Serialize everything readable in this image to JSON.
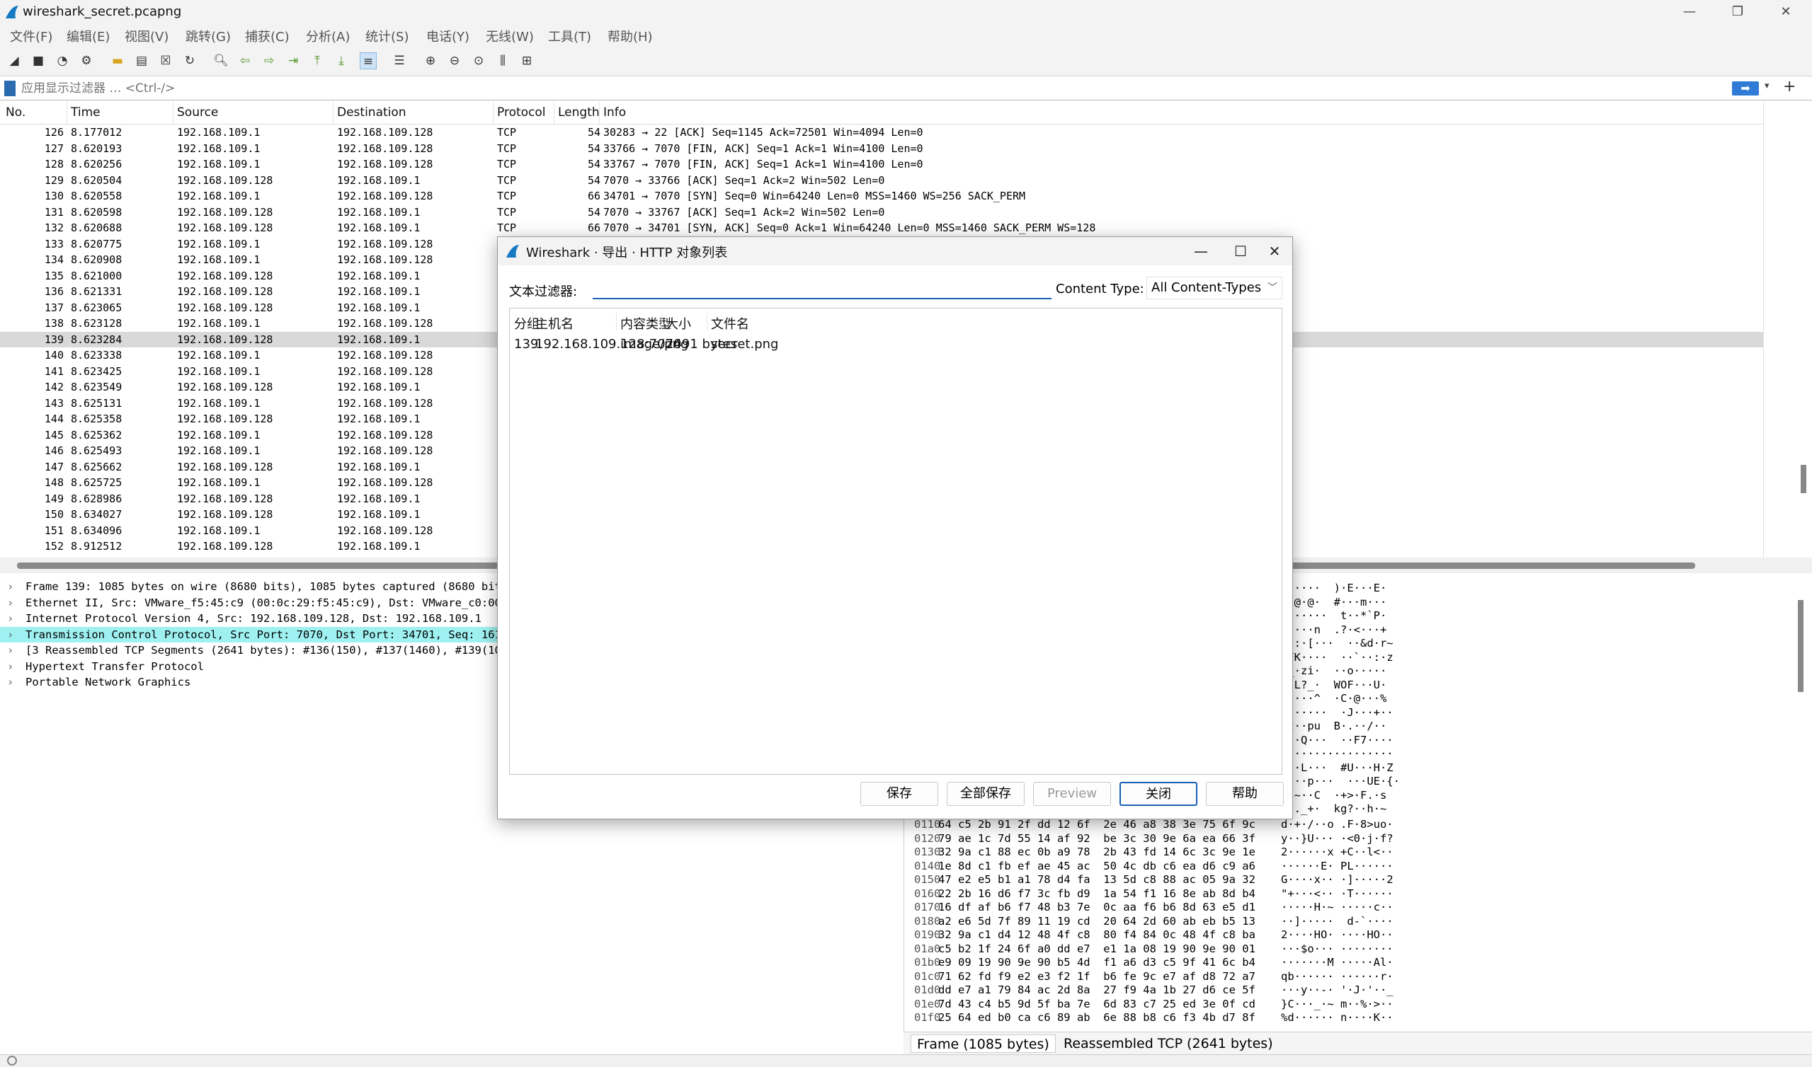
{
  "window": {
    "title": "wireshark_secret.pcapng",
    "controls": {
      "minimize": "—",
      "maximize": "❐",
      "close": "✕"
    }
  },
  "menubar": {
    "items": [
      "文件(F)",
      "编辑(E)",
      "视图(V)",
      "跳转(G)",
      "捕获(C)",
      "分析(A)",
      "统计(S)",
      "电话(Y)",
      "无线(W)",
      "工具(T)",
      "帮助(H)"
    ]
  },
  "filter": {
    "placeholder": "应用显示过滤器 … <Ctrl-/>"
  },
  "packet_list": {
    "columns": [
      "No.",
      "Time",
      "Source",
      "Destination",
      "Protocol",
      "Length",
      "Info"
    ],
    "rows": [
      {
        "no": "126",
        "time": "8.177012",
        "src": "192.168.109.1",
        "dst": "192.168.109.128",
        "proto": "TCP",
        "len": "54",
        "info": "30283 → 22 [ACK] Seq=1145 Ack=72501 Win=4094 Len=0"
      },
      {
        "no": "127",
        "time": "8.620193",
        "src": "192.168.109.1",
        "dst": "192.168.109.128",
        "proto": "TCP",
        "len": "54",
        "info": "33766 → 7070 [FIN, ACK] Seq=1 Ack=1 Win=4100 Len=0"
      },
      {
        "no": "128",
        "time": "8.620256",
        "src": "192.168.109.1",
        "dst": "192.168.109.128",
        "proto": "TCP",
        "len": "54",
        "info": "33767 → 7070 [FIN, ACK] Seq=1 Ack=1 Win=4100 Len=0"
      },
      {
        "no": "129",
        "time": "8.620504",
        "src": "192.168.109.128",
        "dst": "192.168.109.1",
        "proto": "TCP",
        "len": "54",
        "info": "7070 → 33766 [ACK] Seq=1 Ack=2 Win=502 Len=0"
      },
      {
        "no": "130",
        "time": "8.620558",
        "src": "192.168.109.1",
        "dst": "192.168.109.128",
        "proto": "TCP",
        "len": "66",
        "info": "34701 → 7070 [SYN] Seq=0 Win=64240 Len=0 MSS=1460 WS=256 SACK_PERM"
      },
      {
        "no": "131",
        "time": "8.620598",
        "src": "192.168.109.128",
        "dst": "192.168.109.1",
        "proto": "TCP",
        "len": "54",
        "info": "7070 → 33767 [ACK] Seq=1 Ack=2 Win=502 Len=0"
      },
      {
        "no": "132",
        "time": "8.620688",
        "src": "192.168.109.128",
        "dst": "192.168.109.1",
        "proto": "TCP",
        "len": "66",
        "info": "7070 → 34701 [SYN, ACK] Seq=0 Ack=1 Win=64240 Len=0 MSS=1460 SACK_PERM WS=128"
      },
      {
        "no": "133",
        "time": "8.620775",
        "src": "192.168.109.1",
        "dst": "192.168.109.128",
        "proto": "TCP",
        "len": "",
        "info": ""
      },
      {
        "no": "134",
        "time": "8.620908",
        "src": "192.168.109.1",
        "dst": "192.168.109.128",
        "proto": "TCP",
        "len": "",
        "info": ""
      },
      {
        "no": "135",
        "time": "8.621000",
        "src": "192.168.109.128",
        "dst": "192.168.109.1",
        "proto": "TCP",
        "len": "",
        "info": ""
      },
      {
        "no": "136",
        "time": "8.621331",
        "src": "192.168.109.128",
        "dst": "192.168.109.1",
        "proto": "TCP",
        "len": "",
        "info": ""
      },
      {
        "no": "137",
        "time": "8.623065",
        "src": "192.168.109.128",
        "dst": "192.168.109.1",
        "proto": "TCP",
        "len": "",
        "info": ""
      },
      {
        "no": "138",
        "time": "8.623128",
        "src": "192.168.109.1",
        "dst": "192.168.109.128",
        "proto": "TCP",
        "len": "",
        "info": ""
      },
      {
        "no": "139",
        "time": "8.623284",
        "src": "192.168.109.128",
        "dst": "192.168.109.1",
        "proto": "",
        "len": "",
        "info": "",
        "selected": true
      },
      {
        "no": "140",
        "time": "8.623338",
        "src": "192.168.109.1",
        "dst": "192.168.109.128",
        "proto": "TCP",
        "len": "",
        "info": ""
      },
      {
        "no": "141",
        "time": "8.623425",
        "src": "192.168.109.1",
        "dst": "192.168.109.128",
        "proto": "TCP",
        "len": "",
        "info": ""
      },
      {
        "no": "142",
        "time": "8.623549",
        "src": "192.168.109.128",
        "dst": "192.168.109.1",
        "proto": "TCP",
        "len": "",
        "info": ""
      },
      {
        "no": "143",
        "time": "8.625131",
        "src": "192.168.109.1",
        "dst": "192.168.109.128",
        "proto": "TCP",
        "len": "",
        "info": ""
      },
      {
        "no": "144",
        "time": "8.625358",
        "src": "192.168.109.128",
        "dst": "192.168.109.1",
        "proto": "TCP",
        "len": "",
        "info": ""
      },
      {
        "no": "145",
        "time": "8.625362",
        "src": "192.168.109.1",
        "dst": "192.168.109.128",
        "proto": "TCP",
        "len": "",
        "info": ""
      },
      {
        "no": "146",
        "time": "8.625493",
        "src": "192.168.109.1",
        "dst": "192.168.109.128",
        "proto": "TCP",
        "len": "",
        "info": ""
      },
      {
        "no": "147",
        "time": "8.625662",
        "src": "192.168.109.128",
        "dst": "192.168.109.1",
        "proto": "TCP",
        "len": "",
        "info": ""
      },
      {
        "no": "148",
        "time": "8.625725",
        "src": "192.168.109.1",
        "dst": "192.168.109.128",
        "proto": "TCP",
        "len": "",
        "info": ""
      },
      {
        "no": "149",
        "time": "8.628986",
        "src": "192.168.109.128",
        "dst": "192.168.109.1",
        "proto": "TCP",
        "len": "",
        "info": ""
      },
      {
        "no": "150",
        "time": "8.634027",
        "src": "192.168.109.128",
        "dst": "192.168.109.1",
        "proto": "TCP",
        "len": "",
        "info": ""
      },
      {
        "no": "151",
        "time": "8.634096",
        "src": "192.168.109.1",
        "dst": "192.168.109.128",
        "proto": "TCP",
        "len": "",
        "info": ""
      },
      {
        "no": "152",
        "time": "8.912512",
        "src": "192.168.109.128",
        "dst": "192.168.109.1",
        "proto": "TCP",
        "len": "",
        "info": ""
      }
    ]
  },
  "details": [
    {
      "text": "Frame 139: 1085 bytes on wire (8680 bits), 1085 bytes captured (8680 bits"
    },
    {
      "text": "Ethernet II, Src: VMware_f5:45:c9 (00:0c:29:f5:45:c9), Dst: VMware_c0:00:0"
    },
    {
      "text": "Internet Protocol Version 4, Src: 192.168.109.128, Dst: 192.168.109.1"
    },
    {
      "text": "Transmission Control Protocol, Src Port: 7070, Dst Port: 34701, Seq: 1611",
      "highlight": true
    },
    {
      "text": "[3 Reassembled TCP Segments (2641 bytes): #136(150), #137(1460), #139(103"
    },
    {
      "text": "Hypertext Transfer Protocol"
    },
    {
      "text": "Portable Network Graphics"
    }
  ],
  "hex_ascii_right_top": [
    "V·····  )·E···E·",
    "··@·@·  #···m···",
    "·······  t··*`P·",
    "·····n  .?·<···+",
    "··:·[···  ··&d·r~",
    "·FK····  ··`··:·z",
    "·_·zi·  ··o·····",
    "··L?_·  WOF···U·",
    "·····^  ·C·@···%",
    "·······  ·J···+··",
    "·z··pu  B·.··/··",
    "·\\·Q···  ··F7····",
    "·················",
    "o··L···  #U···H·Z",
    "····p···  ···UE·{·",
    "··~··C  ·+>·F.·s",
    "·{._+·  kg?··h·~"
  ],
  "hex_rows": [
    {
      "off": "0110",
      "hex": "64 c5 2b 91 2f dd 12 6f  2e 46 a8 38 3e 75 6f 9c",
      "ascii": "d·+·/··o .F·8>uo·"
    },
    {
      "off": "0120",
      "hex": "79 ae 1c 7d 55 14 af 92  be 3c 30 9e 6a ea 66 3f",
      "ascii": "y··}U··· ·<0·j·f?"
    },
    {
      "off": "0130",
      "hex": "32 9a c1 88 ec 0b a9 78  2b 43 fd 14 6c 3c 9e 1e",
      "ascii": "2······x +C··l<··"
    },
    {
      "off": "0140",
      "hex": "1e 8d c1 fb ef ae 45 ac  50 4c db c6 ea d6 c9 a6",
      "ascii": "······E· PL······"
    },
    {
      "off": "0150",
      "hex": "47 e2 e5 b1 a1 78 d4 fa  13 5d c8 88 ac 05 9a 32",
      "ascii": "G····x·· ·]·····2"
    },
    {
      "off": "0160",
      "hex": "22 2b 16 d6 f7 3c fb d9  1a 54 f1 16 8e ab 8d b4",
      "ascii": "\"+···<·· ·T······"
    },
    {
      "off": "0170",
      "hex": "16 df af b6 f7 48 b3 7e  0c aa f6 b6 8d 63 e5 d1",
      "ascii": "·····H·~ ·····c··"
    },
    {
      "off": "0180",
      "hex": "a2 e6 5d 7f 89 11 19 cd  20 64 2d 60 ab eb b5 13",
      "ascii": "··]·····  d-`····"
    },
    {
      "off": "0190",
      "hex": "32 9a c1 d4 12 48 4f c8  80 f4 84 0c 48 4f c8 ba",
      "ascii": "2····HO· ····HO··"
    },
    {
      "off": "01a0",
      "hex": "c5 b2 1f 24 6f a0 dd e7  e1 1a 08 19 90 9e 90 01",
      "ascii": "···$o··· ········"
    },
    {
      "off": "01b0",
      "hex": "e9 09 19 90 9e 90 b5 4d  f1 a6 d3 c5 9f 41 6c b4",
      "ascii": "·······M ·····Al·"
    },
    {
      "off": "01c0",
      "hex": "71 62 fd f9 e2 e3 f2 1f  b6 fe 9c e7 af d8 72 a7",
      "ascii": "qb······ ······r·"
    },
    {
      "off": "01d0",
      "hex": "dd e7 a1 79 84 ac 2d 8a  27 f9 4a 1b 27 d6 ce 5f",
      "ascii": "···y··-· '·J·'··_"
    },
    {
      "off": "01e0",
      "hex": "7d 43 c4 b5 9d 5f ba 7e  6d 83 c7 25 ed 3e 0f cd",
      "ascii": "}C···_·~ m··%·>··"
    },
    {
      "off": "01f0",
      "hex": "25 64 ed b0 ca c6 89 ab  6e 88 b8 c6 f3 4b d7 8f",
      "ascii": "%d······ n····K··"
    }
  ],
  "hex_tabs": [
    "Frame (1085 bytes)",
    "Reassembled TCP (2641 bytes)"
  ],
  "dialog": {
    "title": "Wireshark · 导出 · HTTP 对象列表",
    "filter_label": "文本过滤器:",
    "filter_value": "",
    "content_type_label": "Content Type:",
    "content_type_value": "All Content-Types",
    "columns": [
      "分组",
      "主机名",
      "内容类型",
      "大小",
      "文件名"
    ],
    "rows": [
      {
        "packet": "139",
        "host": "192.168.109.128:7070",
        "ctype": "image/png",
        "size": "2491 bytes",
        "filename": "secret.png"
      }
    ],
    "buttons": {
      "save": "保存",
      "save_all": "全部保存",
      "preview": "Preview",
      "close": "关闭",
      "help": "帮助"
    }
  },
  "colors": {
    "accent": "#1a5fb4",
    "selected_row": "#d9d9d9",
    "tcp_highlight": "#9ff1f1"
  }
}
